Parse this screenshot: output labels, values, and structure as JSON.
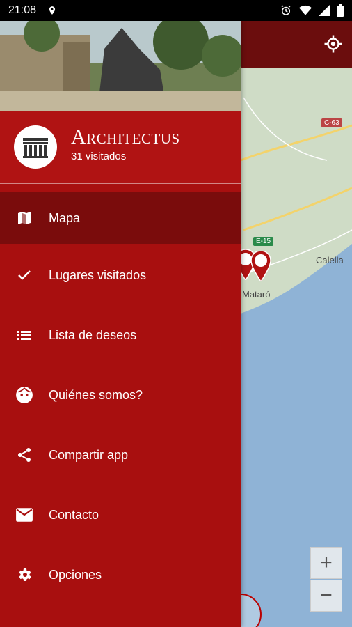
{
  "status_bar": {
    "time": "21:08"
  },
  "drawer": {
    "app_title": "Architectus",
    "visited_count": "31 visitados",
    "items": [
      {
        "label": "Mapa",
        "icon": "map-icon",
        "active": true
      },
      {
        "label": "Lugares visitados",
        "icon": "check-icon"
      },
      {
        "label": "Lista de deseos",
        "icon": "list-icon"
      },
      {
        "label": "Quiénes somos?",
        "icon": "face-icon"
      },
      {
        "label": "Compartir app",
        "icon": "share-icon"
      },
      {
        "label": "Contacto",
        "icon": "mail-icon"
      },
      {
        "label": "Opciones",
        "icon": "settings-icon"
      }
    ]
  },
  "map": {
    "labels": {
      "city1": "Mataró",
      "city2": "Calella"
    },
    "roads": {
      "r1": "C-63",
      "r2": "E-15"
    },
    "zoom_in": "+",
    "zoom_out": "−"
  },
  "colors": {
    "primary": "#a80f0f",
    "active": "#7a0c0c",
    "toolbar": "#6b0d0d"
  }
}
